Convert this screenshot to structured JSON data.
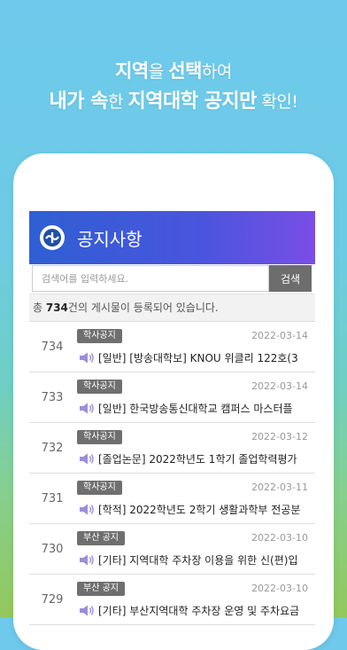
{
  "promo": {
    "line1_a": "지역",
    "line1_b": "을 ",
    "line1_c": "선택",
    "line1_d": "하여",
    "line2_a": "내가 속",
    "line2_b": "한 ",
    "line2_c": "지역대학 공지만",
    "line2_d": " 확인!"
  },
  "app": {
    "title": "공지사항",
    "search": {
      "placeholder": "검색어를 입력하세요.",
      "button": "검색"
    },
    "count": {
      "prefix": "총 ",
      "value": "734",
      "suffix": "건의 게시물이 등록되어 있습니다."
    }
  },
  "notices": [
    {
      "num": "734",
      "category": "학사공지",
      "date": "2022-03-14",
      "title": "[일반] [방송대학보] KNOU 위클리 122호(3"
    },
    {
      "num": "733",
      "category": "학사공지",
      "date": "2022-03-14",
      "title": "[일반] 한국방송통신대학교 캠퍼스 마스터플"
    },
    {
      "num": "732",
      "category": "학사공지",
      "date": "2022-03-12",
      "title": "[졸업논문] 2022학년도 1학기 졸업학력평가"
    },
    {
      "num": "731",
      "category": "학사공지",
      "date": "2022-03-11",
      "title": "[학적] 2022학년도 2학기 생활과학부 전공분"
    },
    {
      "num": "730",
      "category": "부산 공지",
      "date": "2022-03-10",
      "title": "[기타] 지역대학 주차장 이용을 위한 신(편)입"
    },
    {
      "num": "729",
      "category": "부산 공지",
      "date": "2022-03-10",
      "title": "[기타] 부산지역대학 주차장 운영 및 주차요금"
    }
  ],
  "colors": {
    "appbar_start": "#2f5fd3",
    "appbar_end": "#7a4ee6",
    "badge": "#6f6f6f",
    "speaker_icon": "#9a8fd8"
  }
}
